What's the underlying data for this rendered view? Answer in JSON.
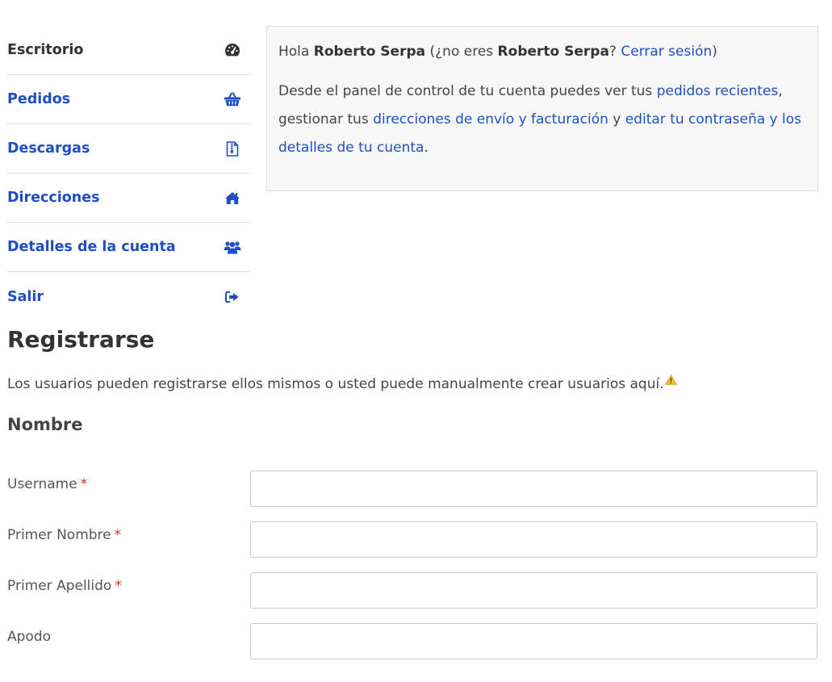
{
  "nav": {
    "items": [
      {
        "label": "Escritorio",
        "icon": "dashboard-gauge-icon",
        "active": true
      },
      {
        "label": "Pedidos",
        "icon": "shopping-basket-icon"
      },
      {
        "label": "Descargas",
        "icon": "file-download-icon"
      },
      {
        "label": "Direcciones",
        "icon": "home-icon"
      },
      {
        "label": "Detalles de la cuenta",
        "icon": "users-icon"
      },
      {
        "label": "Salir",
        "icon": "sign-out-icon"
      }
    ]
  },
  "dashboard": {
    "hello": "Hola",
    "user_name": "Roberto Serpa",
    "not_you_prefix": "(¿no eres",
    "not_you_name": "Roberto Serpa",
    "question_mark": "?",
    "logout_link": "Cerrar sesión",
    "close_paren": ")",
    "desc_1": "Desde el panel de control de tu cuenta puedes ver tus",
    "link_orders": "pedidos recientes",
    "desc_2": ", gestionar tus",
    "link_addresses": "direcciones de envío y facturación",
    "desc_3": "y",
    "link_account": "editar tu contraseña y los detalles de tu cuenta",
    "desc_end": "."
  },
  "register": {
    "title": "Registrarse",
    "description": "Los usuarios pueden registrarse ellos mismos o usted puede manualmente crear usuarios aquí.",
    "warning_icon": "warning-triangle-icon",
    "section_title": "Nombre",
    "fields": [
      {
        "label": "Username",
        "required": "*",
        "value": ""
      },
      {
        "label": "Primer Nombre",
        "required": "*",
        "value": ""
      },
      {
        "label": "Primer Apellido",
        "required": "*",
        "value": ""
      },
      {
        "label": "Apodo",
        "required": "",
        "value": ""
      }
    ]
  },
  "colors": {
    "link": "#1f4fc1",
    "text": "#444444",
    "required": "#dd2222",
    "box_bg": "#f7f7f7",
    "border": "#dddddd"
  }
}
